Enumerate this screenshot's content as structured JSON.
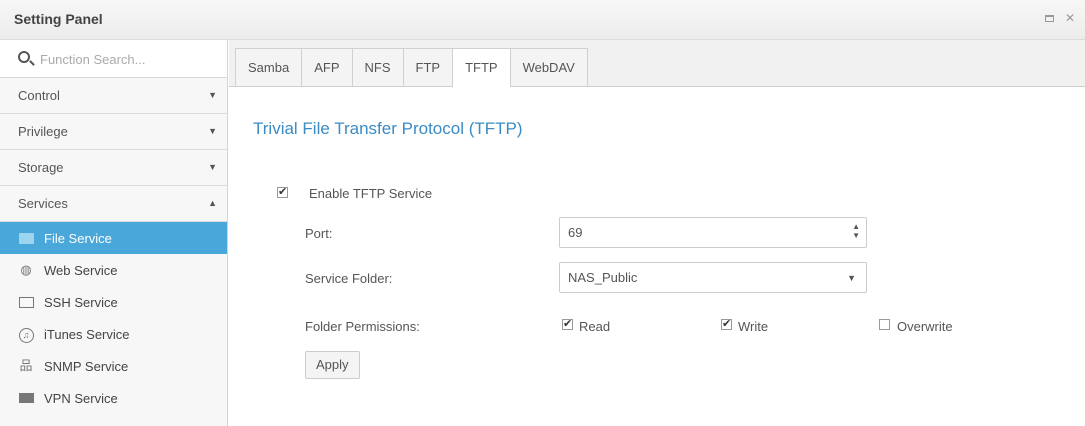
{
  "window": {
    "title": "Setting Panel"
  },
  "sidebar": {
    "search_placeholder": "Function Search...",
    "categories": [
      {
        "label": "Control",
        "arrow": "▼"
      },
      {
        "label": "Privilege",
        "arrow": "▼"
      },
      {
        "label": "Storage",
        "arrow": "▼"
      },
      {
        "label": "Services",
        "arrow": "▲"
      }
    ],
    "services": [
      {
        "label": "File Service",
        "icon": "folder-icon"
      },
      {
        "label": "Web Service",
        "icon": "globe-icon"
      },
      {
        "label": "SSH Service",
        "icon": "terminal-icon"
      },
      {
        "label": "iTunes Service",
        "icon": "music-icon"
      },
      {
        "label": "SNMP Service",
        "icon": "network-icon"
      },
      {
        "label": "VPN Service",
        "icon": "vpn-icon"
      }
    ]
  },
  "tabs": [
    "Samba",
    "AFP",
    "NFS",
    "FTP",
    "TFTP",
    "WebDAV"
  ],
  "active_tab": "TFTP",
  "tftp": {
    "heading": "Trivial File Transfer Protocol (TFTP)",
    "enable_label": "Enable TFTP Service",
    "enable_checked": true,
    "port_label": "Port:",
    "port_value": "69",
    "folder_label": "Service Folder:",
    "folder_value": "NAS_Public",
    "perm_label": "Folder Permissions:",
    "read_label": "Read",
    "read_checked": true,
    "write_label": "Write",
    "write_checked": true,
    "overwrite_label": "Overwrite",
    "overwrite_checked": false,
    "apply_label": "Apply"
  },
  "colors": {
    "accent": "#4aa7d9",
    "heading": "#3b8bc4"
  }
}
